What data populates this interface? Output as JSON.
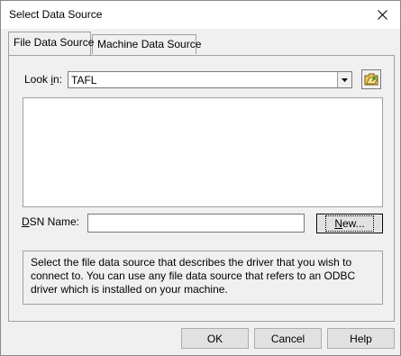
{
  "window": {
    "title": "Select Data Source"
  },
  "tabs": [
    {
      "label": "File Data Source",
      "active": true
    },
    {
      "label": "Machine Data Source",
      "active": false
    }
  ],
  "look_in": {
    "label": "Look in:",
    "value": "TAFL"
  },
  "dsn": {
    "label": "DSN Name:",
    "value": "",
    "new_button": "New..."
  },
  "description": "Select the file data source that describes the driver that you wish to connect to. You can use any file data source that refers to an ODBC driver which is installed on your machine.",
  "footer": {
    "ok": "OK",
    "cancel": "Cancel",
    "help": "Help"
  }
}
